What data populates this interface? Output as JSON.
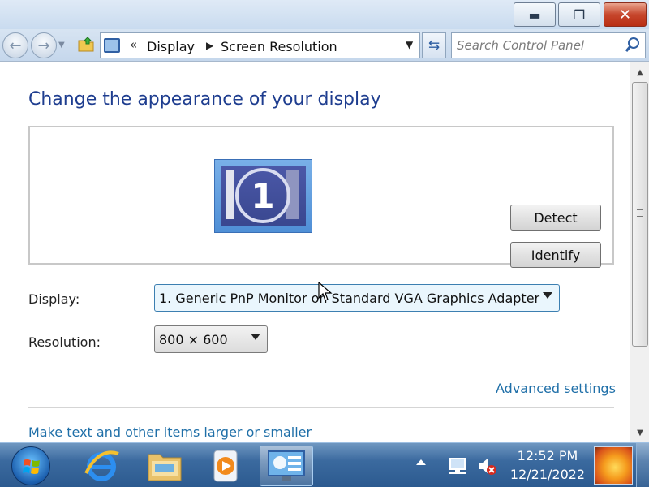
{
  "window": {
    "minimize_icon": "minimize-icon",
    "maximize_icon": "restore-icon",
    "close_icon": "close-icon"
  },
  "navigation": {
    "breadcrumb": [
      "Display",
      "Screen Resolution"
    ],
    "chevron": "«",
    "search_placeholder": "Search Control Panel"
  },
  "main": {
    "title": "Change the appearance of your display",
    "monitor_number": "1",
    "detect_label": "Detect",
    "identify_label": "Identify",
    "display_label": "Display:",
    "display_value": "1. Generic PnP Monitor on Standard VGA Graphics Adapter",
    "resolution_label": "Resolution:",
    "resolution_value": "800 × 600",
    "advanced_link": "Advanced settings",
    "text_size_link": "Make text and other items larger or smaller"
  },
  "taskbar": {
    "apps": [
      "internet-explorer",
      "windows-explorer",
      "media-player",
      "display-settings"
    ],
    "active_app": "display-settings",
    "time": "12:52 PM",
    "date": "12/21/2022"
  },
  "colors": {
    "title": "#1e3d8f",
    "link": "#1f6fa8",
    "taskbar": "#3b6a9f"
  }
}
